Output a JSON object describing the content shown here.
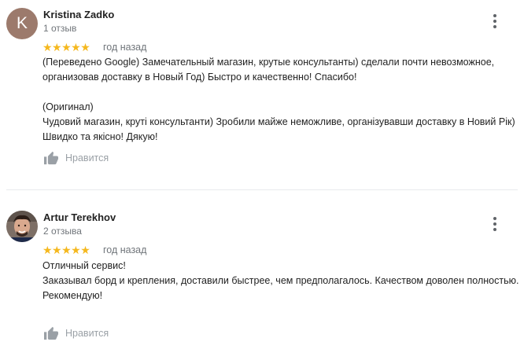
{
  "reviews": [
    {
      "author": "Kristina Zadko",
      "avatar_letter": "K",
      "review_count": "1 отзыв",
      "stars": "★★★★★",
      "rating": 5,
      "time": "год назад",
      "text_translated": "(Переведено Google) Замечательный магазин, крутые консультанты) сделали почти невозможное, организовав доставку в Новый Год) Быстро и качественно! Спасибо!",
      "original_label": "(Оригинал)",
      "text_original": "Чудовий магазин, круті консультанти) Зробили майже неможливе, організувавши доставку в Новий Рік) Швидко та якісно! Дякую!",
      "like_label": "Нравится"
    },
    {
      "author": "Artur Terekhov",
      "review_count": "2 отзыва",
      "stars": "★★★★★",
      "rating": 5,
      "time": "год назад",
      "text": "Отличный сервис!\nЗаказывал борд и крепления, доставили быстрее, чем предполагалось. Качеством доволен полностью.\nРекомендую!",
      "like_label": "Нравится"
    }
  ],
  "colors": {
    "star": "#f5b81e",
    "secondary_text": "#70757a",
    "like": "#9aa0a6",
    "avatar_bg": "#9c7a6c"
  }
}
